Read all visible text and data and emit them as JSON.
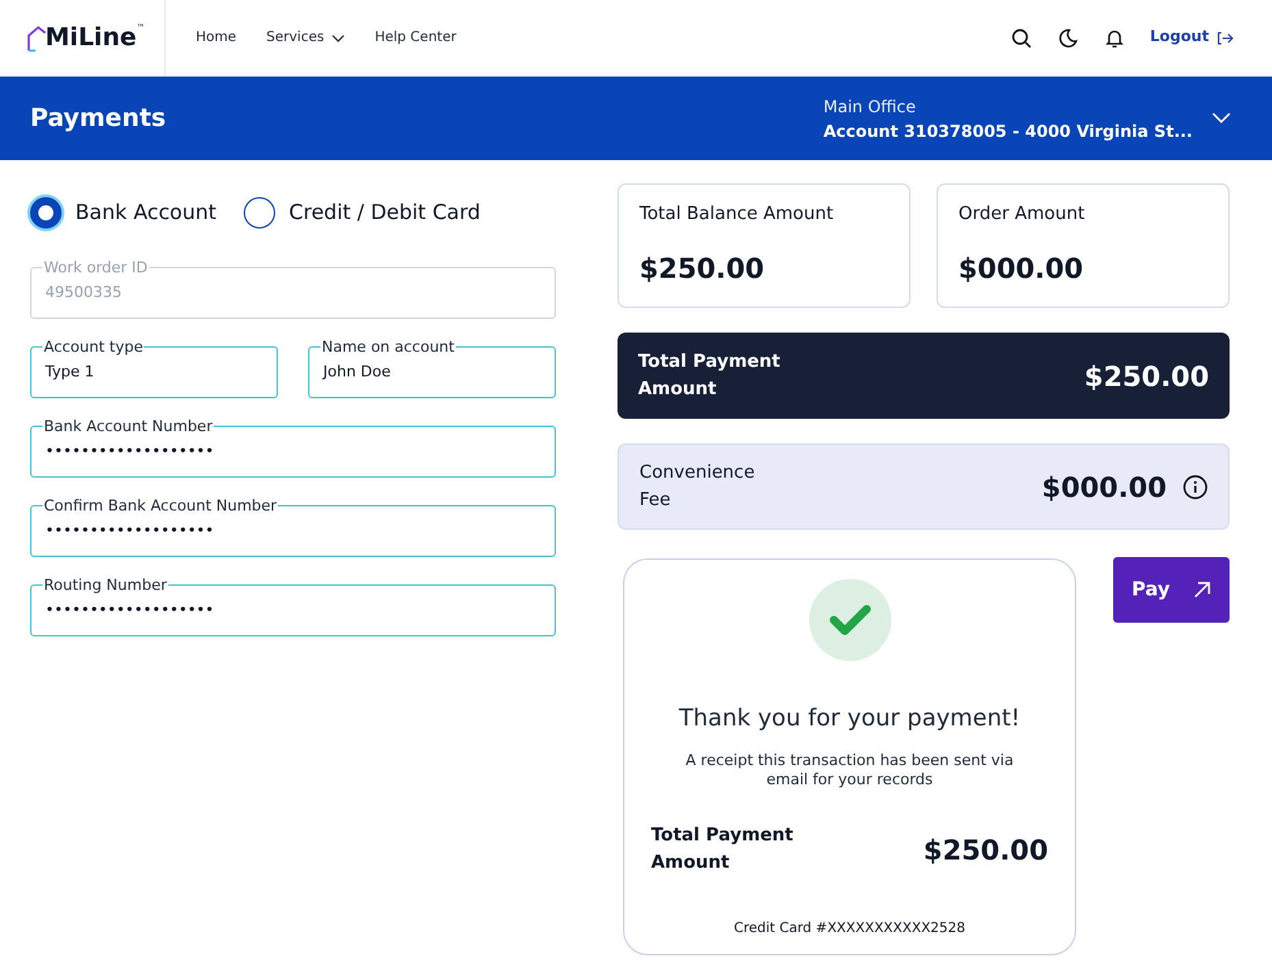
{
  "header": {
    "logo": "MiLine",
    "logo_mark": "™",
    "nav": [
      {
        "label": "Home",
        "dropdown": false
      },
      {
        "label": "Services",
        "dropdown": true
      },
      {
        "label": "Help Center",
        "dropdown": false
      }
    ],
    "logout": "Logout"
  },
  "banner": {
    "title": "Payments",
    "office": "Main Office",
    "account": "Account 310378005 - 4000 Virginia St..."
  },
  "payment_methods": [
    {
      "label": "Bank Account",
      "selected": true
    },
    {
      "label": "Credit / Debit Card",
      "selected": false
    }
  ],
  "field_rows": [
    [
      {
        "label": "Work order ID",
        "value": "49500335",
        "disabled": true
      }
    ],
    [
      {
        "label": "Account type",
        "value": "Type 1",
        "disabled": false
      },
      {
        "label": "Name on account",
        "value": "John Doe",
        "disabled": false
      }
    ],
    [
      {
        "label": "Bank Account Number",
        "value": "•••••••••••••••••••",
        "disabled": false
      }
    ],
    [
      {
        "label": "Confirm Bank Account Number",
        "value": "•••••••••••••••••••",
        "disabled": false
      }
    ],
    [
      {
        "label": "Routing Number",
        "value": "•••••••••••••••••••",
        "disabled": false
      }
    ]
  ],
  "summary_cards": [
    {
      "label": "Total Balance Amount",
      "amount": "$250.00"
    },
    {
      "label": "Order Amount",
      "amount": "$000.00"
    }
  ],
  "total_payment": {
    "label": "Total Payment Amount",
    "amount": "$250.00"
  },
  "convenience_fee": {
    "label": "Convenience Fee",
    "amount": "$000.00"
  },
  "pay_button": "Pay",
  "receipt": {
    "title": "Thank you for your payment!",
    "message": "A receipt this transaction has been sent via email for your records",
    "total_label": "Total Payment Amount",
    "total": "$250.00",
    "card": "Credit Card #XXXXXXXXXXX2528"
  }
}
